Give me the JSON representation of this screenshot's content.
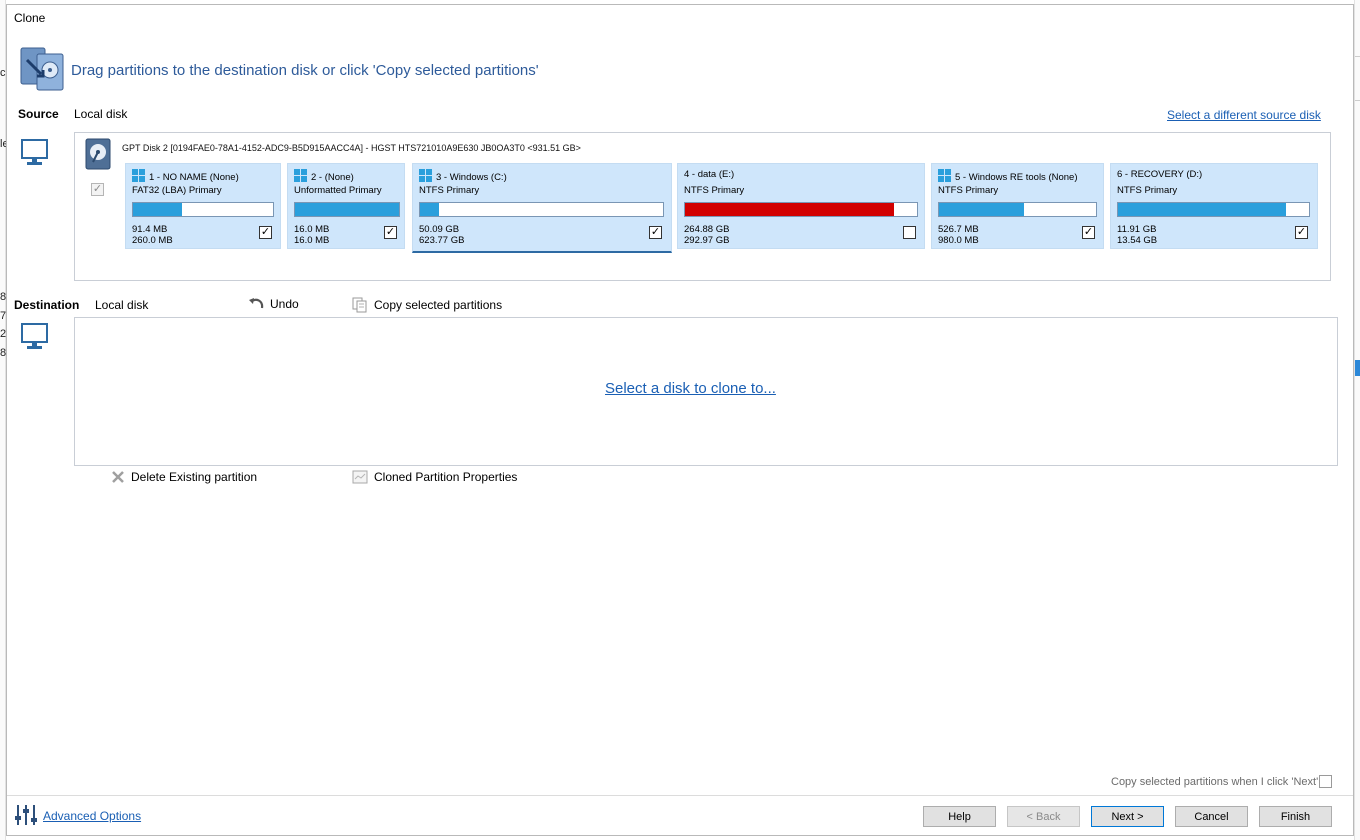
{
  "window": {
    "title": "Clone",
    "instruction": "Drag partitions to the destination disk or click 'Copy selected partitions'"
  },
  "source": {
    "label": "Source",
    "disk_type": "Local disk",
    "select_different_link": "Select a different source disk",
    "disk_header": "GPT Disk 2 [0194FAE0-78A1-4152-ADC9-B5D915AACC4A] - HGST HTS721010A9E630 JB0OA3T0  <931.51 GB>",
    "partitions": [
      {
        "title": "1 - NO NAME (None)",
        "type": "FAT32 (LBA) Primary",
        "used": "91.4 MB",
        "total": "260.0 MB",
        "fill": 0.35,
        "checked": true,
        "windows_icon": true,
        "bar_color": "#2a9fdc"
      },
      {
        "title": "2 -  (None)",
        "type": "Unformatted Primary",
        "used": "16.0 MB",
        "total": "16.0 MB",
        "fill": 1.0,
        "checked": true,
        "windows_icon": true,
        "bar_color": "#2a9fdc"
      },
      {
        "title": "3 - Windows (C:)",
        "type": "NTFS Primary",
        "used": "50.09 GB",
        "total": "623.77 GB",
        "fill": 0.08,
        "checked": true,
        "windows_icon": true,
        "bar_color": "#2a9fdc"
      },
      {
        "title": "4 - data (E:)",
        "type": "NTFS Primary",
        "used": "264.88 GB",
        "total": "292.97 GB",
        "fill": 0.9,
        "checked": false,
        "windows_icon": false,
        "bar_color": "#d20000"
      },
      {
        "title": "5 - Windows RE tools (None)",
        "type": "NTFS Primary",
        "used": "526.7 MB",
        "total": "980.0 MB",
        "fill": 0.54,
        "checked": true,
        "windows_icon": true,
        "bar_color": "#2a9fdc"
      },
      {
        "title": "6 - RECOVERY (D:)",
        "type": "NTFS Primary",
        "used": "11.91 GB",
        "total": "13.54 GB",
        "fill": 0.88,
        "checked": true,
        "windows_icon": false,
        "bar_color": "#2a9fdc"
      }
    ]
  },
  "destination": {
    "label": "Destination",
    "disk_type": "Local disk",
    "undo_label": "Undo",
    "copy_selected_label": "Copy selected partitions",
    "select_disk_link": "Select a disk to clone to...",
    "delete_existing_label": "Delete Existing partition",
    "cloned_props_label": "Cloned Partition Properties"
  },
  "footer": {
    "copy_when_next": "Copy selected partitions when I click 'Next'",
    "advanced_options": "Advanced Options",
    "help": "Help",
    "back": "< Back",
    "next": "Next >",
    "cancel": "Cancel",
    "finish": "Finish"
  },
  "background_chars": [
    "c",
    "le",
    "8",
    "7",
    "2",
    "8"
  ],
  "icons": {
    "wizard": "disk-clone-wizard-icon",
    "source_computer": "computer-monitor-icon",
    "dest_computer": "computer-monitor-icon",
    "disk": "hard-disk-icon",
    "undo": "undo-arrow-icon",
    "copy": "copy-document-icon",
    "delete": "delete-x-icon",
    "properties": "properties-icon",
    "advanced": "sliders-icon"
  }
}
